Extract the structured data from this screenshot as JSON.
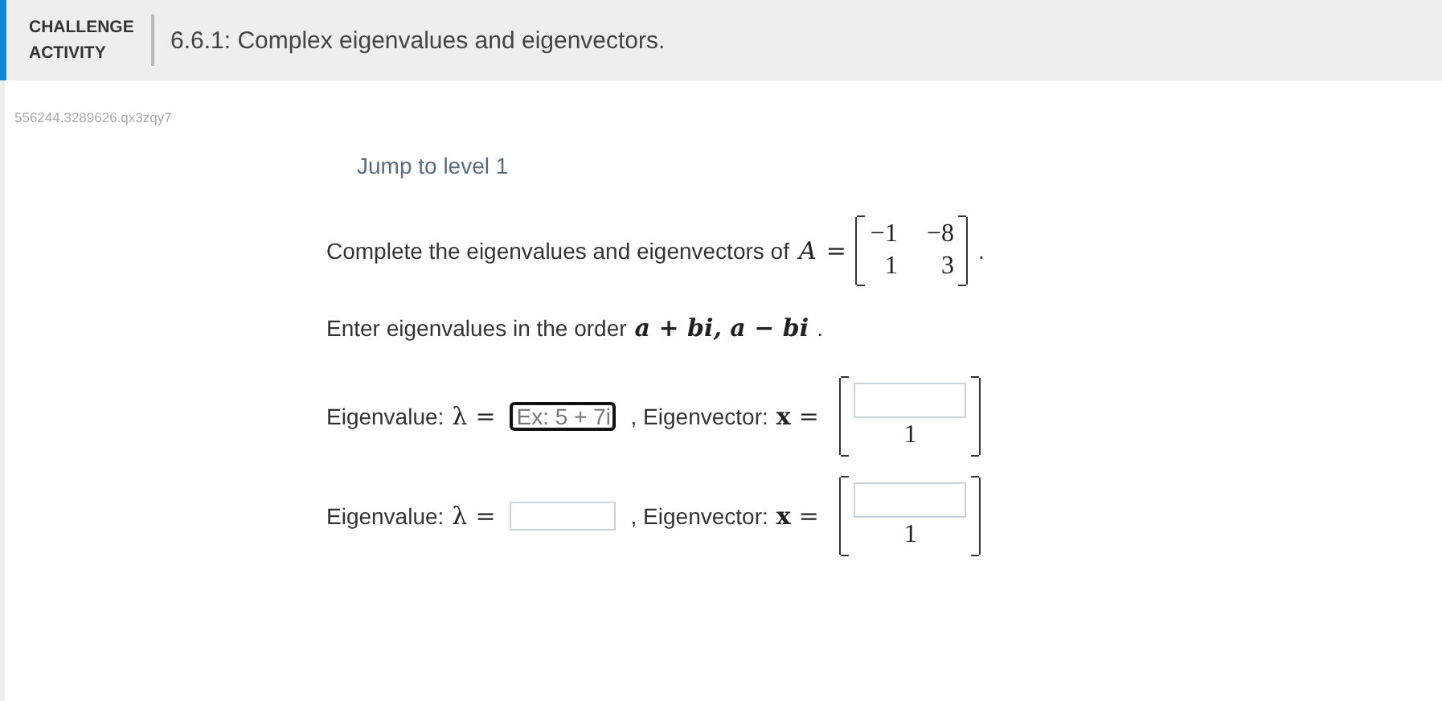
{
  "header": {
    "badge": "CHALLENGE ACTIVITY",
    "title": "6.6.1: Complex eigenvalues and eigenvectors."
  },
  "activity_code": "556244.3289626.qx3zqy7",
  "jump_link": "Jump to level 1",
  "question": {
    "intro": "Complete the eigenvalues and eigenvectors of",
    "matrix_name": "A",
    "equals": "=",
    "matrix": [
      [
        "−1",
        "−8"
      ],
      [
        "1",
        "3"
      ]
    ],
    "period": "."
  },
  "instruction": {
    "text": "Enter eigenvalues in the order",
    "math": "a + bi, a − bi",
    "period": "."
  },
  "rows": [
    {
      "eigenvalue_label": "Eigenvalue:",
      "symbol": "λ",
      "equals": "=",
      "eigenvalue": {
        "placeholder": "Ex: 5 + 7i",
        "focused": true
      },
      "eigenvector_label": ", Eigenvector:",
      "vector_symbol": "x",
      "vector_equals": "=",
      "vector": [
        {
          "kind": "input"
        },
        {
          "kind": "text",
          "text": "1"
        }
      ]
    },
    {
      "eigenvalue_label": "Eigenvalue:",
      "symbol": "λ",
      "equals": "=",
      "eigenvalue": {
        "focused": false
      },
      "eigenvector_label": ", Eigenvector:",
      "vector_symbol": "x",
      "vector_equals": "=",
      "vector": [
        {
          "kind": "input"
        },
        {
          "kind": "text",
          "text": "1"
        }
      ]
    }
  ]
}
